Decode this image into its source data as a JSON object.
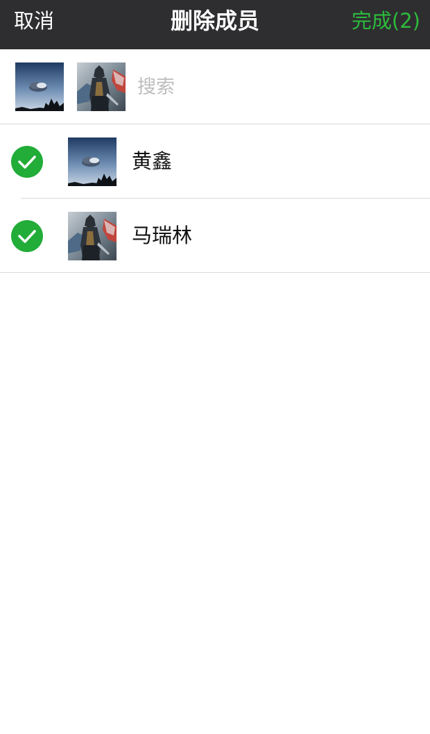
{
  "navbar": {
    "cancel_label": "取消",
    "title": "删除成员",
    "done_label": "完成(2)",
    "done_color": "#2dbb3c"
  },
  "search": {
    "placeholder": "搜索",
    "value": "",
    "selected_avatars": [
      "sky-cloud-avatar-icon",
      "hooded-figure-avatar-icon"
    ]
  },
  "members": [
    {
      "name": "黄鑫",
      "checked": true,
      "avatar": "sky-cloud-avatar-icon"
    },
    {
      "name": "马瑞林",
      "checked": true,
      "avatar": "hooded-figure-avatar-icon"
    }
  ],
  "colors": {
    "navbar_bg": "#2e2e31",
    "check_green": "#22ac38",
    "divider": "#d9d9d9"
  }
}
